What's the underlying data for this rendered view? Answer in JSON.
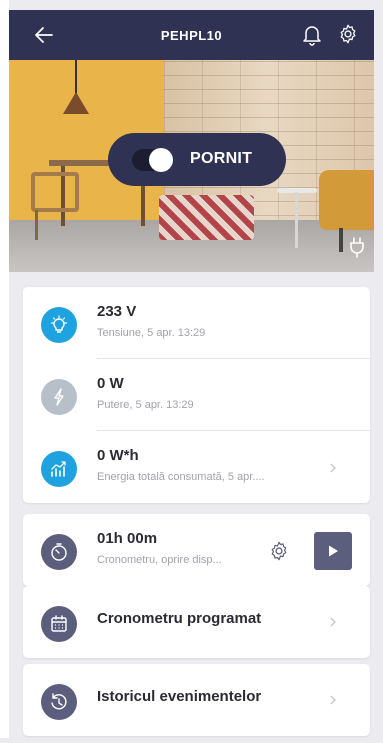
{
  "header": {
    "title": "PEHPL10",
    "back_icon": "arrow-left-icon",
    "bell_icon": "bell-icon",
    "settings_icon": "gear-icon"
  },
  "hero": {
    "toggle_label": "PORNIT",
    "toggle_state": "on",
    "plug_icon": "plug-icon"
  },
  "metrics": [
    {
      "value": "233 V",
      "caption": "Tensiune, 5 apr. 13:29",
      "icon": "lightbulb-icon",
      "color": "#1ea2e0"
    },
    {
      "value": "0 W",
      "caption": "Putere, 5 apr. 13:29",
      "icon": "lightning-icon",
      "color": "#b7bfc9"
    },
    {
      "value": "0 W*h",
      "caption": "Energia totală consumată, 5 apr....",
      "icon": "energy-chart-icon",
      "color": "#1ea2e0"
    }
  ],
  "timer": {
    "value": "01h 00m",
    "caption": "Cronometru, oprire disp...",
    "icon": "stopwatch-icon",
    "color": "#5b5e7c"
  },
  "scheduled": {
    "label": "Cronometru programat",
    "icon": "calendar-icon",
    "color": "#5b5e7c"
  },
  "history": {
    "label": "Istoricul evenimentelor",
    "icon": "history-clock-icon",
    "color": "#5b5e7c"
  },
  "colors": {
    "header_bg": "#2f3253",
    "accent_blue": "#1ea2e0",
    "muted_icon": "#b7bfc9",
    "dark_icon": "#5b5e7c"
  }
}
